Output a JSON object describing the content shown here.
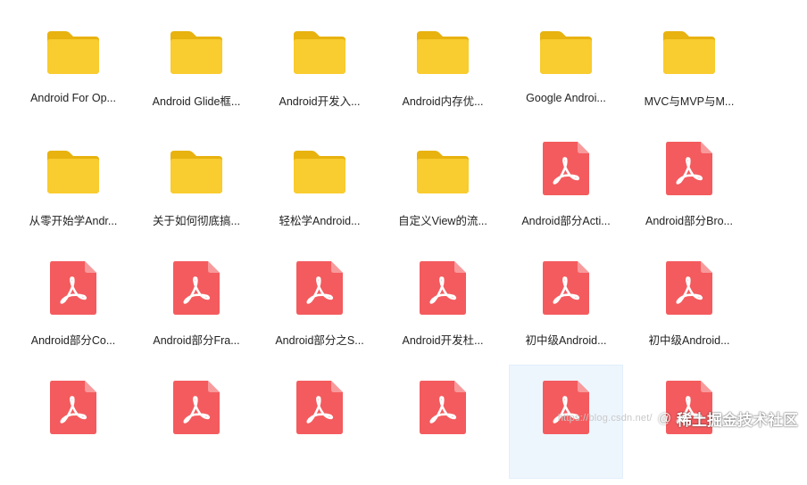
{
  "colors": {
    "folder_back": "#E8B20F",
    "folder_front": "#F9CC2F",
    "pdf_body": "#F45B5E",
    "pdf_fold": "#F89A9C",
    "pdf_glyph": "#FFFFFF",
    "selection": "#EEF6FD"
  },
  "items": [
    {
      "type": "folder",
      "label": "Android For Op..."
    },
    {
      "type": "folder",
      "label": "Android Glide框..."
    },
    {
      "type": "folder",
      "label": "Android开发入..."
    },
    {
      "type": "folder",
      "label": "Android内存优..."
    },
    {
      "type": "folder",
      "label": "Google Androi..."
    },
    {
      "type": "folder",
      "label": "MVC与MVP与M..."
    },
    {
      "type": "folder",
      "label": "从零开始学Andr..."
    },
    {
      "type": "folder",
      "label": "关于如何彻底搞..."
    },
    {
      "type": "folder",
      "label": "轻松学Android..."
    },
    {
      "type": "folder",
      "label": "自定义View的流..."
    },
    {
      "type": "pdf",
      "label": "Android部分Acti..."
    },
    {
      "type": "pdf",
      "label": "Android部分Bro..."
    },
    {
      "type": "pdf",
      "label": "Android部分Co..."
    },
    {
      "type": "pdf",
      "label": "Android部分Fra..."
    },
    {
      "type": "pdf",
      "label": "Android部分之S..."
    },
    {
      "type": "pdf",
      "label": "Android开发杜..."
    },
    {
      "type": "pdf",
      "label": "初中级Android..."
    },
    {
      "type": "pdf",
      "label": "初中级Android..."
    },
    {
      "type": "pdf",
      "label": ""
    },
    {
      "type": "pdf",
      "label": ""
    },
    {
      "type": "pdf",
      "label": ""
    },
    {
      "type": "pdf",
      "label": ""
    },
    {
      "type": "pdf",
      "label": "",
      "selected": true
    },
    {
      "type": "pdf",
      "label": ""
    }
  ],
  "watermark": {
    "url": "https://blog.csdn.net/",
    "at": "@",
    "text": "稀土掘金技术社区"
  }
}
